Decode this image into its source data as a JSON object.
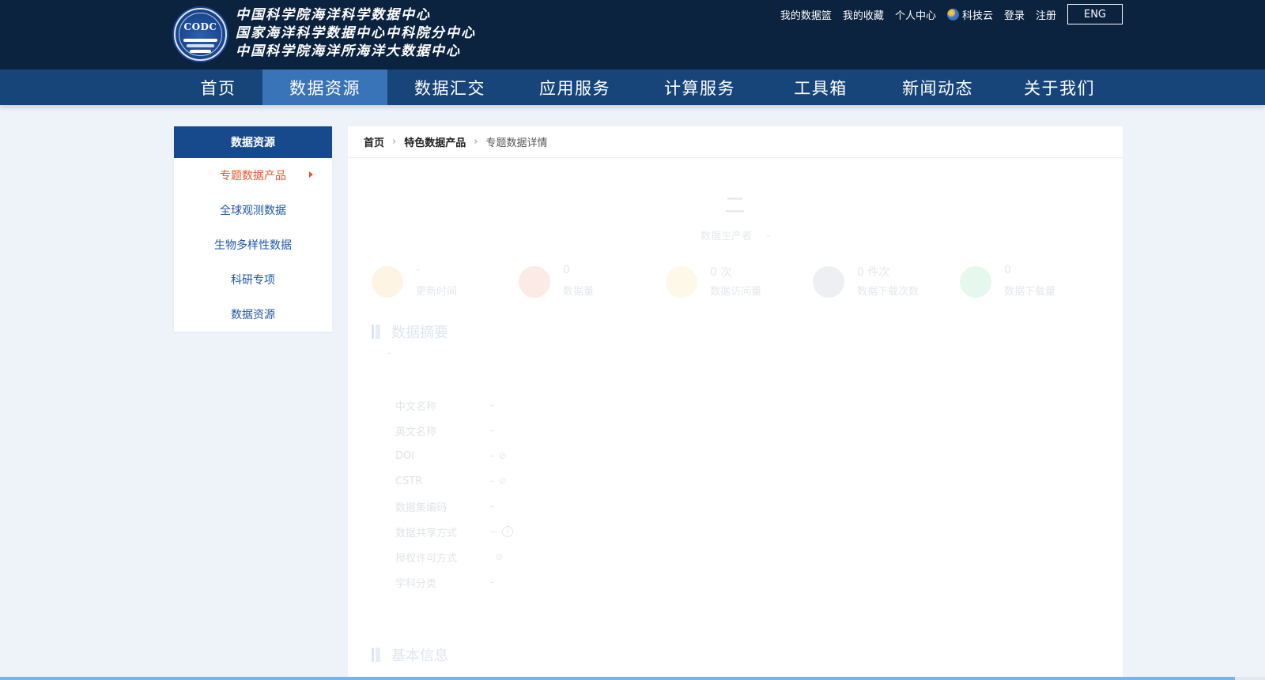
{
  "header": {
    "logo_text": "CODC",
    "org_names": [
      "中国科学院海洋科学数据中心",
      "国家海洋科学数据中心中科院分中心",
      "中国科学院海洋所海洋大数据中心"
    ],
    "links": [
      "我的数据篮",
      "我的收藏",
      "个人中心",
      "科技云",
      "登录",
      "注册"
    ],
    "lang_button": "ENG"
  },
  "nav": {
    "items": [
      "首页",
      "数据资源",
      "数据汇交",
      "应用服务",
      "计算服务",
      "工具箱",
      "新闻动态",
      "关于我们"
    ],
    "active_index": 1
  },
  "sidebar": {
    "title": "数据资源",
    "items": [
      "专题数据产品",
      "全球观测数据",
      "生物多样性数据",
      "科研专项",
      "数据资源"
    ],
    "active_index": 0
  },
  "breadcrumb": [
    "首页",
    "特色数据产品",
    "专题数据详情"
  ],
  "detail": {
    "title": "二",
    "producer_label": "数据生产者",
    "producer_value": "-",
    "stats": [
      {
        "value": "-",
        "label": "更新时间",
        "color": "#f6a623"
      },
      {
        "value": "0",
        "label": "数据量",
        "color": "#e8542f"
      },
      {
        "value": "0 次",
        "label": "数据访问量",
        "color": "#f0c93a"
      },
      {
        "value": "0 件次",
        "label": "数据下载次数",
        "color": "#6b7a99"
      },
      {
        "value": "0",
        "label": "数据下载量",
        "color": "#2ebd6e"
      }
    ],
    "summary_title": "数据摘要",
    "summary_text": "-",
    "info": [
      {
        "key": "中文名称",
        "value": "-"
      },
      {
        "key": "英文名称",
        "value": "-"
      },
      {
        "key": "DOI",
        "value": "-"
      },
      {
        "key": "CSTR",
        "value": "-"
      },
      {
        "key": "数据集编码",
        "value": "-"
      },
      {
        "key": "数据共享方式",
        "value": "--"
      },
      {
        "key": "授权许可方式",
        "value": ""
      },
      {
        "key": "学科分类",
        "value": "-"
      }
    ],
    "basic_title": "基本信息"
  },
  "progress_percent": 97.6
}
